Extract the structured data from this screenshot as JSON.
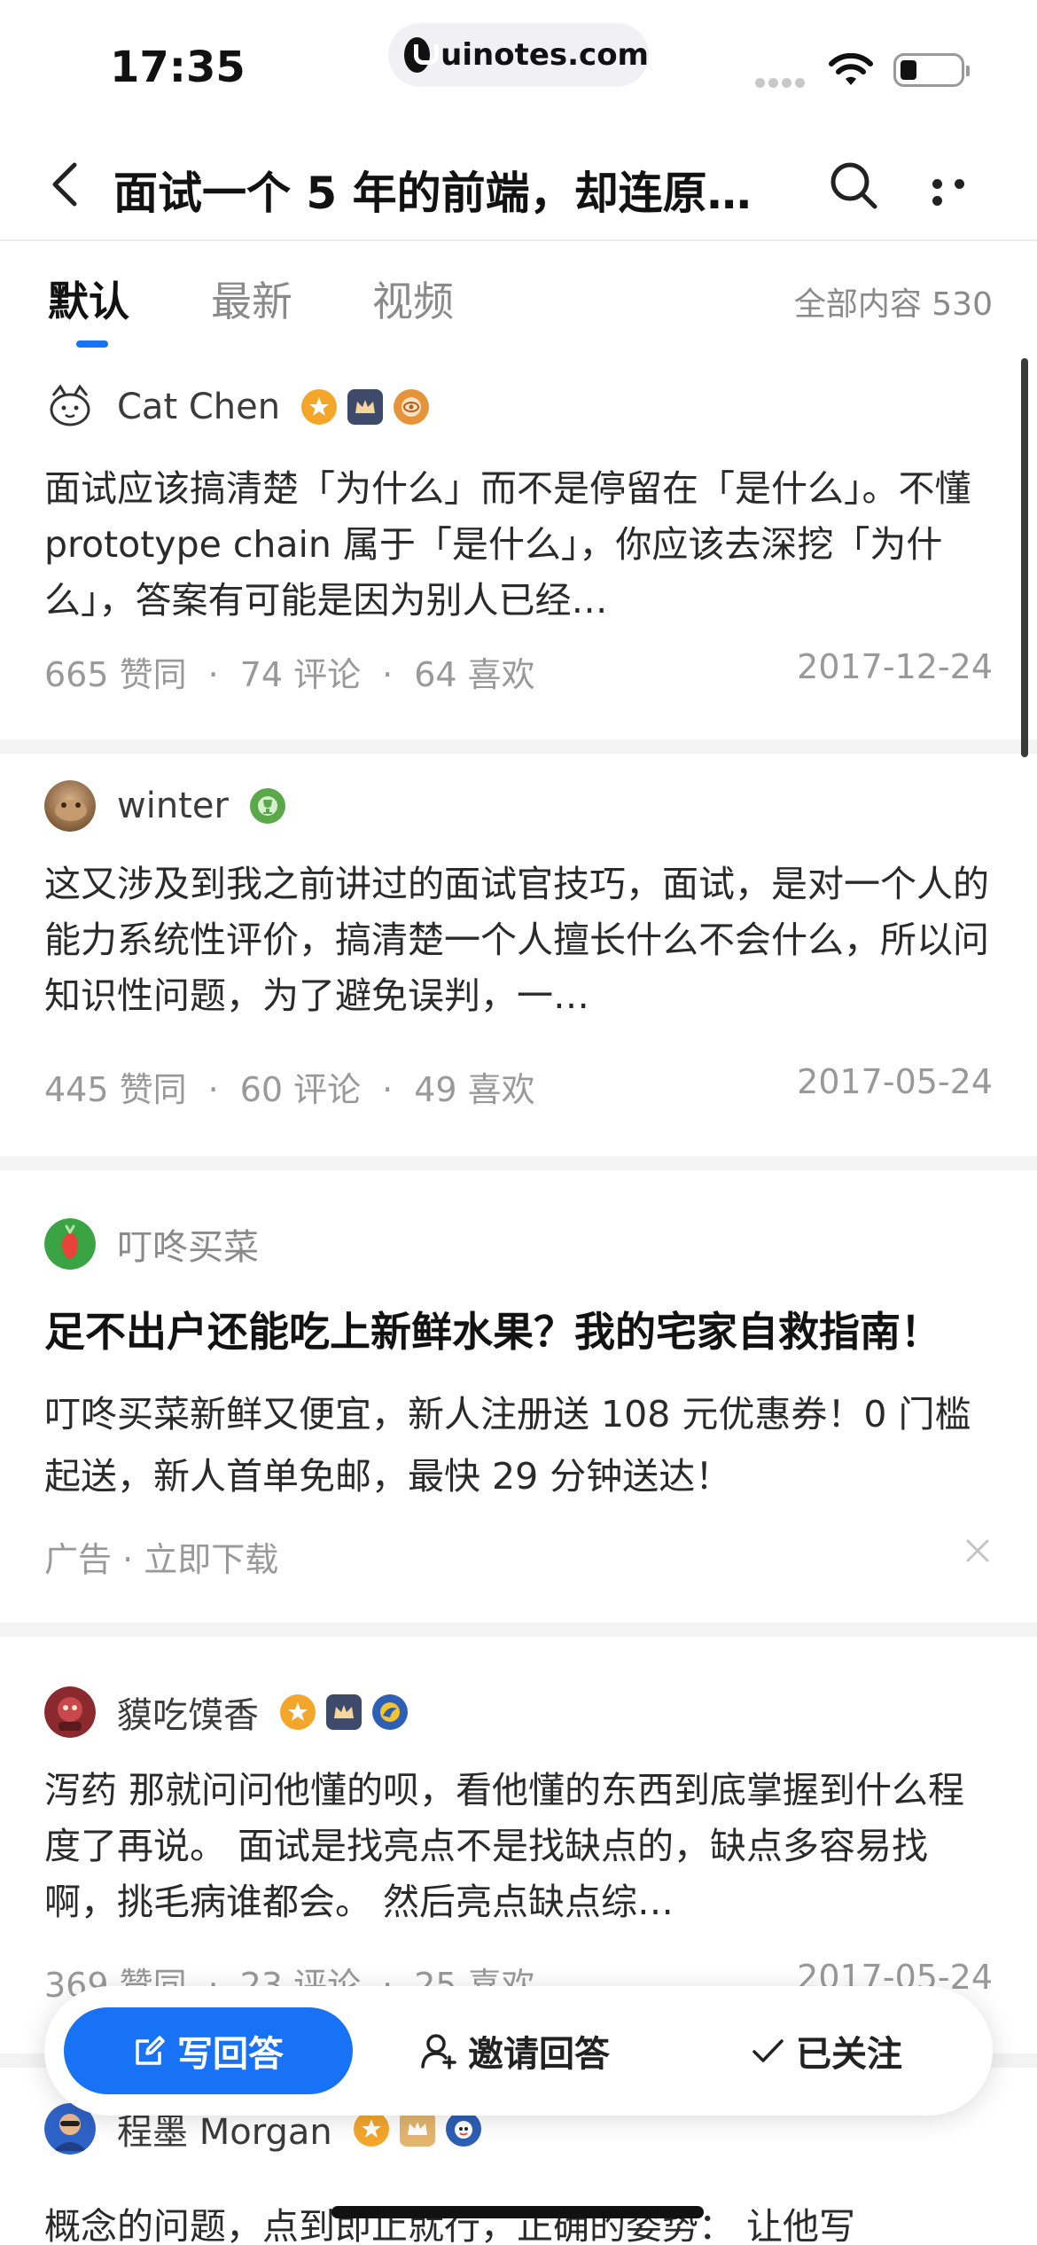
{
  "status_bar": {
    "time": "17:35",
    "url": "uinotes.com"
  },
  "nav": {
    "title": "面试一个 5 年的前端，却连原…",
    "back_icon": "chevron-left-icon",
    "search_icon": "search-icon",
    "more_icon": "more-horizontal-icon"
  },
  "tabs": {
    "items": [
      {
        "label": "默认"
      },
      {
        "label": "最新"
      },
      {
        "label": "视频"
      }
    ],
    "active_index": 0,
    "total": "全部内容 530"
  },
  "answers": [
    {
      "author": "Cat Chen",
      "excerpt": "面试应该搞清楚「为什么」而不是停留在「是什么」。不懂 prototype chain 属于「是什么」，你应该去深挖「为什么」，答案有可能是因为别人已经…",
      "upvotes": "665 赞同",
      "comments": "74 评论",
      "likes": "64 喜欢",
      "date": "2017-12-24"
    },
    {
      "author": "winter",
      "excerpt": "这又涉及到我之前讲过的面试官技巧，面试，是对一个人的能力系统性评价，搞清楚一个人擅长什么不会什么，所以问知识性问题，为了避免误判，一…",
      "upvotes": "445 赞同",
      "comments": "60 评论",
      "likes": "49 喜欢",
      "date": "2017-05-24"
    },
    {
      "author": "貘吃馍香",
      "excerpt": "泻药 那就问问他懂的呗，看他懂的东西到底掌握到什么程度了再说。 面试是找亮点不是找缺点的，缺点多容易找啊，挑毛病谁都会。 然后亮点缺点综…",
      "upvotes": "369 赞同",
      "comments": "23 评论",
      "likes": "25 喜欢",
      "date": "2017-05-24"
    },
    {
      "author": "程墨 Morgan",
      "excerpt": "概念的问题，点到即止就行，正确的姿势： 让他写"
    }
  ],
  "ad": {
    "brand": "叮咚买菜",
    "title": "足不出户还能吃上新鲜水果？我的宅家自救指南！",
    "body": "叮咚买菜新鲜又便宜，新人注册送 108 元优惠券！0 门槛起送，新人首单免邮，最快 29 分钟送达！",
    "footer": "广告 · 立即下载",
    "close_icon": "close-icon"
  },
  "actions": {
    "write": "写回答",
    "invite": "邀请回答",
    "follow": "已关注"
  },
  "colors": {
    "accent": "#1772f6",
    "separator": "#f3f3f3",
    "muted": "#999999"
  }
}
